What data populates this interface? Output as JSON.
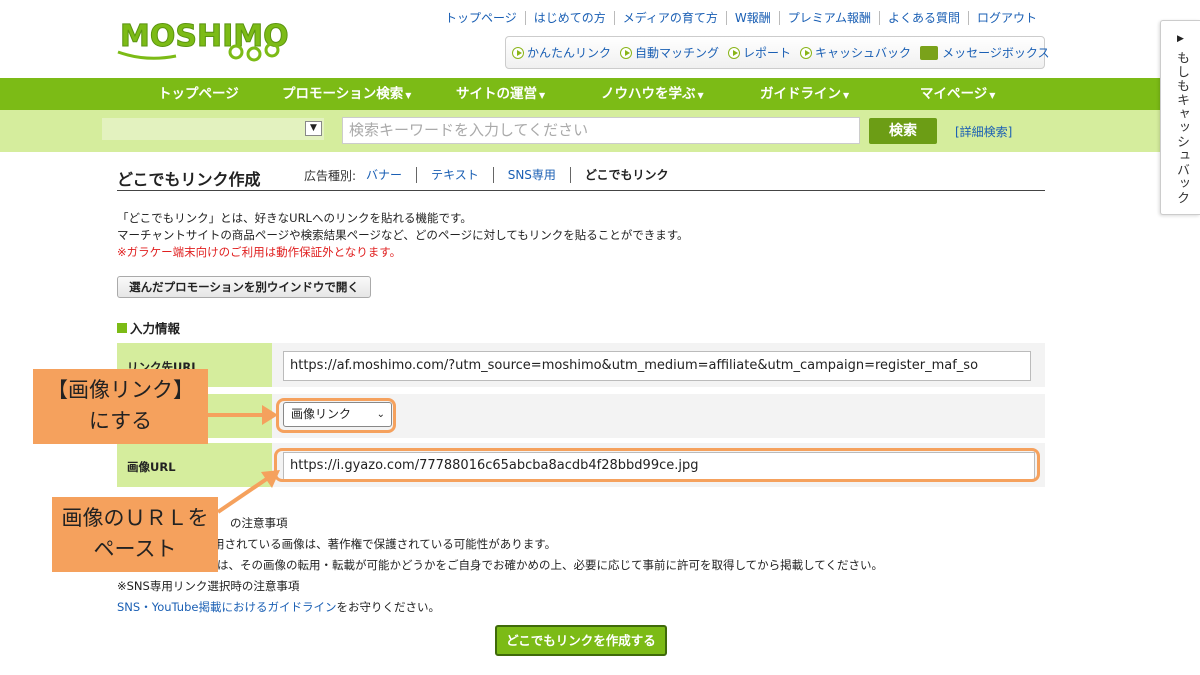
{
  "logo": {
    "text": "MOSHIMO"
  },
  "toplinks": [
    "トップページ",
    "はじめての方",
    "メディアの育て方",
    "W報酬",
    "プレミアム報酬",
    "よくある質問",
    "ログアウト"
  ],
  "quicklinks": [
    "かんたんリンク",
    "自動マッチング",
    "レポート",
    "キャッシュバック",
    "メッセージボックス"
  ],
  "nav": [
    "トップページ",
    "プロモーション検索",
    "サイトの運営",
    "ノウハウを学ぶ",
    "ガイドライン",
    "マイページ"
  ],
  "search": {
    "placeholder": "検索キーワードを入力してください",
    "button": "検索",
    "detail": "[詳細検索]"
  },
  "page": {
    "title": "どこでもリンク作成",
    "tabs_label": "広告種別:",
    "tabs": [
      "バナー",
      "テキスト",
      "SNS専用",
      "どこでもリンク"
    ],
    "desc1": "「どこでもリンク」とは、好きなURLへのリンクを貼れる機能です。",
    "desc2": "マーチャントサイトの商品ページや検索結果ページなど、どのページに対してもリンクを貼ることができます。",
    "desc_warning": "※ガラケー端末向けのご利用は動作保証外となります。",
    "open_button": "選んだプロモーションを別ウインドウで開く",
    "section_title": "入力情報"
  },
  "form": {
    "link_url_label": "リンク先URL",
    "link_url_value": "https://af.moshimo.com/?utm_source=moshimo&utm_medium=affiliate&utm_campaign=register_maf_so",
    "type_value": "画像リンク",
    "image_url_label": "画像URL",
    "image_url_value": "https://i.gyazo.com/77788016c65abcba8acdb4f28bbd99ce.jpg"
  },
  "notes": {
    "n1": "の注意事項",
    "n2": "用されている画像は、著作権で保護されている可能性があります。",
    "n3": "は、その画像の転用・転載が可能かどうかをご自身でお確かめの上、必要に応じて事前に許可を取得してから掲載してください。",
    "n4": "※SNS専用リンク選択時の注意事項",
    "n5_link": "SNS・YouTube掲載におけるガイドライン",
    "n5_text": "をお守りください。"
  },
  "create_button": "どこでもリンクを作成する",
  "annotations": {
    "callout1_line1": "【画像リンク】",
    "callout1_line2": "にする",
    "callout2_line1": "画像のＵＲＬを",
    "callout2_line2": "ペースト"
  },
  "sidetab": {
    "text": "もしもキャッシュバック"
  },
  "colors": {
    "brand_green": "#7cbb16",
    "light_green": "#d5ed9d",
    "annotation": "#f5a15d"
  }
}
